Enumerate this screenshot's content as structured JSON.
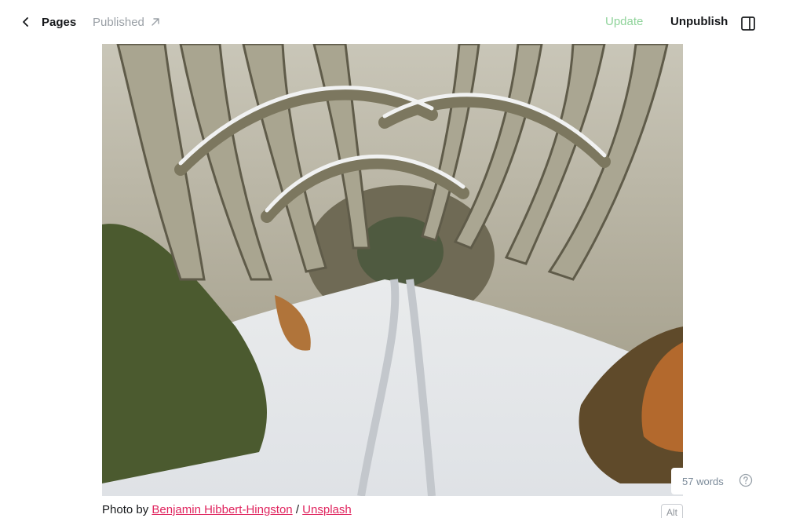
{
  "header": {
    "back_label": "Pages",
    "status_label": "Published",
    "update_label": "Update",
    "unpublish_label": "Unpublish"
  },
  "image": {
    "description": "snowy tree tunnel road"
  },
  "caption": {
    "prefix": "Photo by ",
    "author": "Benjamin Hibbert-Hingston",
    "separator": " / ",
    "source": "Unsplash"
  },
  "alt_label": "Alt",
  "footer": {
    "word_count": "57 words"
  },
  "colors": {
    "accent_link": "#e0245e",
    "update_disabled": "#8fd39a"
  },
  "icons": {
    "back": "chevron-left-icon",
    "status": "arrow-up-right-icon",
    "sidebar": "sidebar-toggle-icon",
    "help": "help-circle-icon"
  }
}
